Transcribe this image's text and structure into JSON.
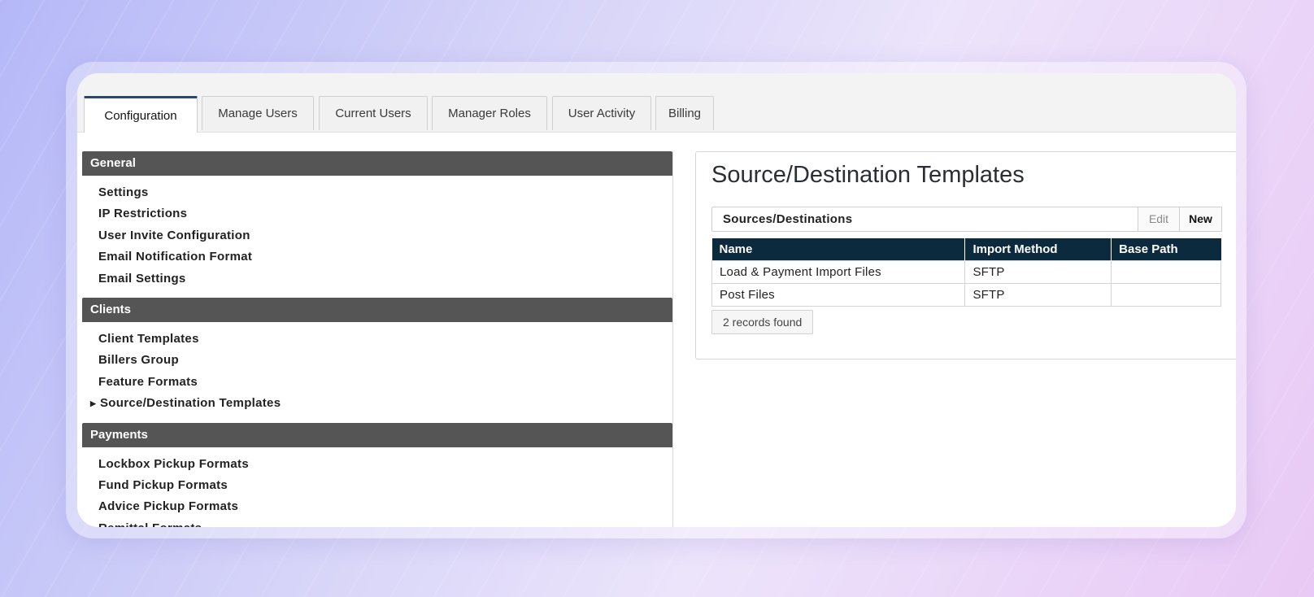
{
  "tabs": [
    {
      "label": "Configuration",
      "active": true
    },
    {
      "label": "Manage Users",
      "active": false
    },
    {
      "label": "Current Users",
      "active": false
    },
    {
      "label": "Manager Roles",
      "active": false
    },
    {
      "label": "User Activity",
      "active": false
    },
    {
      "label": "Billing",
      "active": false
    }
  ],
  "sidebar": {
    "sections": [
      {
        "title": "General",
        "items": [
          "Settings",
          "IP Restrictions",
          "User Invite Configuration",
          "Email Notification Format",
          "Email Settings"
        ]
      },
      {
        "title": "Clients",
        "items": [
          "Client Templates",
          "Billers Group",
          "Feature Formats",
          "Source/Destination Templates"
        ],
        "current": "Source/Destination Templates"
      },
      {
        "title": "Payments",
        "items": [
          "Lockbox Pickup Formats",
          "Fund Pickup Formats",
          "Advice Pickup Formats",
          "Remittal Formats"
        ]
      }
    ],
    "current_marker": "▶"
  },
  "main": {
    "title": "Source/Destination Templates",
    "toolbar": {
      "label": "Sources/Destinations",
      "edit_label": "Edit",
      "new_label": "New"
    },
    "table": {
      "columns": [
        "Name",
        "Import Method",
        "Base Path"
      ],
      "rows": [
        [
          "Load & Payment Import Files",
          "SFTP",
          ""
        ],
        [
          "Post Files",
          "SFTP",
          ""
        ]
      ]
    },
    "records_found": "2 records found"
  },
  "colors": {
    "section_header": "#555555",
    "table_header": "#0c2a3e",
    "active_tab_accent": "#2b4a6b"
  }
}
